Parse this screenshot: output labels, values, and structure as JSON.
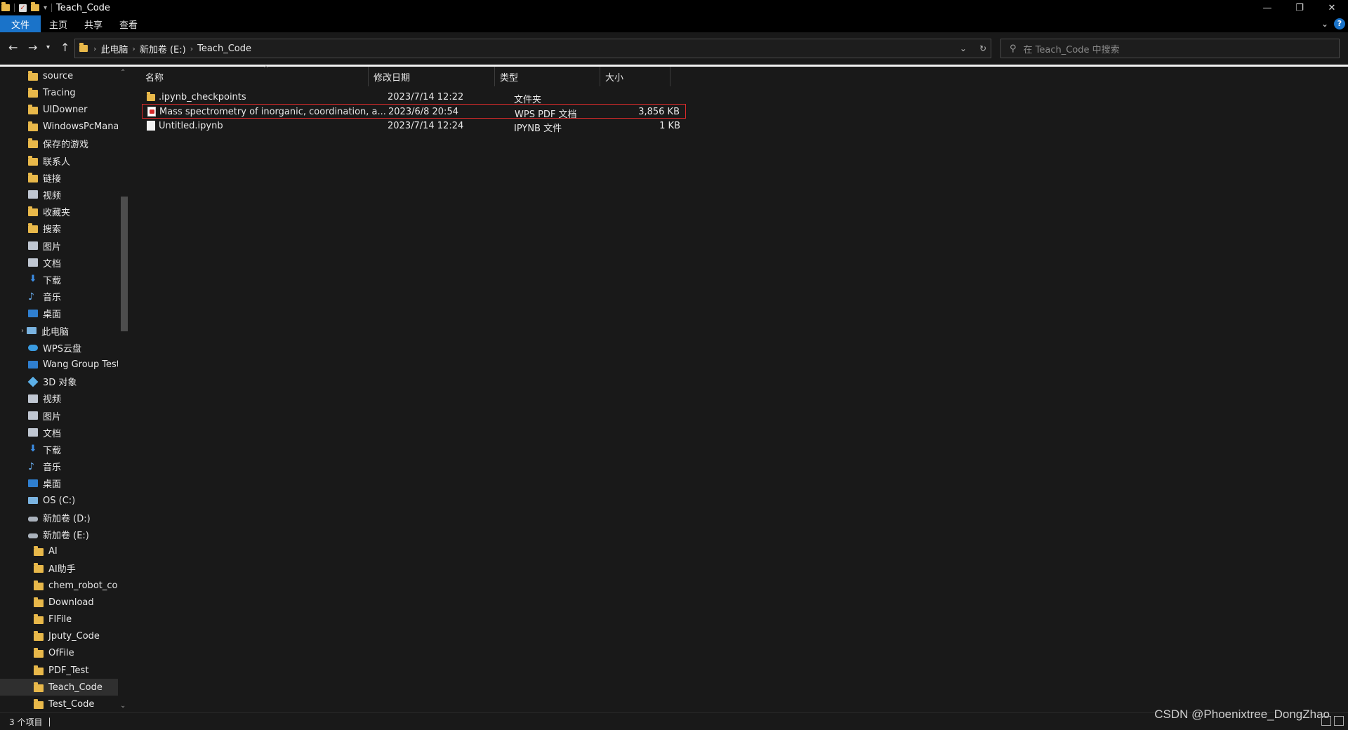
{
  "window": {
    "title": "Teach_Code",
    "controls": [
      "minimize-icon",
      "restore-icon",
      "close-icon"
    ]
  },
  "ribbon": {
    "tabs": [
      "文件",
      "主页",
      "共享",
      "查看"
    ]
  },
  "address": {
    "crumbs": [
      "此电脑",
      "新加卷 (E:)",
      "Teach_Code"
    ],
    "search_placeholder": "在 Teach_Code 中搜索"
  },
  "sidebar": {
    "items": [
      {
        "label": "source",
        "icon": "folder-icon",
        "indent": 0
      },
      {
        "label": "Tracing",
        "icon": "folder-icon",
        "indent": 0
      },
      {
        "label": "UIDowner",
        "icon": "folder-icon",
        "indent": 0
      },
      {
        "label": "WindowsPcManag",
        "icon": "folder-icon",
        "indent": 0
      },
      {
        "label": "保存的游戏",
        "icon": "saved-games-icon",
        "indent": 0
      },
      {
        "label": "联系人",
        "icon": "contacts-icon",
        "indent": 0
      },
      {
        "label": "链接",
        "icon": "links-icon",
        "indent": 0
      },
      {
        "label": "视频",
        "icon": "video-icon",
        "indent": 0
      },
      {
        "label": "收藏夹",
        "icon": "favorites-icon",
        "indent": 0
      },
      {
        "label": "搜索",
        "icon": "search-folder-icon",
        "indent": 0
      },
      {
        "label": "图片",
        "icon": "pictures-icon",
        "indent": 0
      },
      {
        "label": "文档",
        "icon": "documents-icon",
        "indent": 0
      },
      {
        "label": "下载",
        "icon": "download-icon",
        "indent": 0
      },
      {
        "label": "音乐",
        "icon": "music-icon",
        "indent": 0
      },
      {
        "label": "桌面",
        "icon": "desktop-icon",
        "indent": 0
      },
      {
        "label": "此电脑",
        "icon": "this-pc-icon",
        "indent": -1
      },
      {
        "label": "WPS云盘",
        "icon": "wps-cloud-icon",
        "indent": 0
      },
      {
        "label": "Wang Group Test",
        "icon": "network-icon",
        "indent": 0
      },
      {
        "label": "3D 对象",
        "icon": "3d-objects-icon",
        "indent": 0
      },
      {
        "label": "视频",
        "icon": "video-icon",
        "indent": 0
      },
      {
        "label": "图片",
        "icon": "pictures-icon",
        "indent": 0
      },
      {
        "label": "文档",
        "icon": "documents-icon",
        "indent": 0
      },
      {
        "label": "下载",
        "icon": "download-icon",
        "indent": 0
      },
      {
        "label": "音乐",
        "icon": "music-icon",
        "indent": 0
      },
      {
        "label": "桌面",
        "icon": "desktop-icon",
        "indent": 0
      },
      {
        "label": "OS (C:)",
        "icon": "os-drive-icon",
        "indent": 0
      },
      {
        "label": "新加卷 (D:)",
        "icon": "drive-icon",
        "indent": 0
      },
      {
        "label": "新加卷 (E:)",
        "icon": "drive-icon",
        "indent": 0
      },
      {
        "label": "AI",
        "icon": "folder-icon",
        "indent": 1
      },
      {
        "label": "AI助手",
        "icon": "folder-icon",
        "indent": 1
      },
      {
        "label": "chem_robot_code",
        "icon": "folder-icon",
        "indent": 1
      },
      {
        "label": "Download",
        "icon": "folder-icon",
        "indent": 1
      },
      {
        "label": "FIFile",
        "icon": "folder-icon",
        "indent": 1
      },
      {
        "label": "Jputy_Code",
        "icon": "folder-icon",
        "indent": 1
      },
      {
        "label": "OfFile",
        "icon": "folder-icon",
        "indent": 1
      },
      {
        "label": "PDF_Test",
        "icon": "folder-icon",
        "indent": 1
      },
      {
        "label": "Teach_Code",
        "icon": "folder-icon",
        "indent": 1,
        "selected": true
      },
      {
        "label": "Test_Code",
        "icon": "folder-icon",
        "indent": 1
      }
    ]
  },
  "columns": [
    "名称",
    "修改日期",
    "类型",
    "大小"
  ],
  "files": [
    {
      "name": ".ipynb_checkpoints",
      "date": "2023/7/14 12:22",
      "type": "文件夹",
      "size": "",
      "icon": "folder-icon"
    },
    {
      "name": "Mass spectrometry of inorganic, coordination, a...",
      "date": "2023/6/8 20:54",
      "type": "WPS PDF 文档",
      "size": "3,856 KB",
      "icon": "pdf-file-icon",
      "highlighted": true
    },
    {
      "name": "Untitled.ipynb",
      "date": "2023/7/14 12:24",
      "type": "IPYNB 文件",
      "size": "1 KB",
      "icon": "file-icon"
    }
  ],
  "status": {
    "count": "3 个项目"
  },
  "watermark": "CSDN @Phoenixtree_DongZhao"
}
